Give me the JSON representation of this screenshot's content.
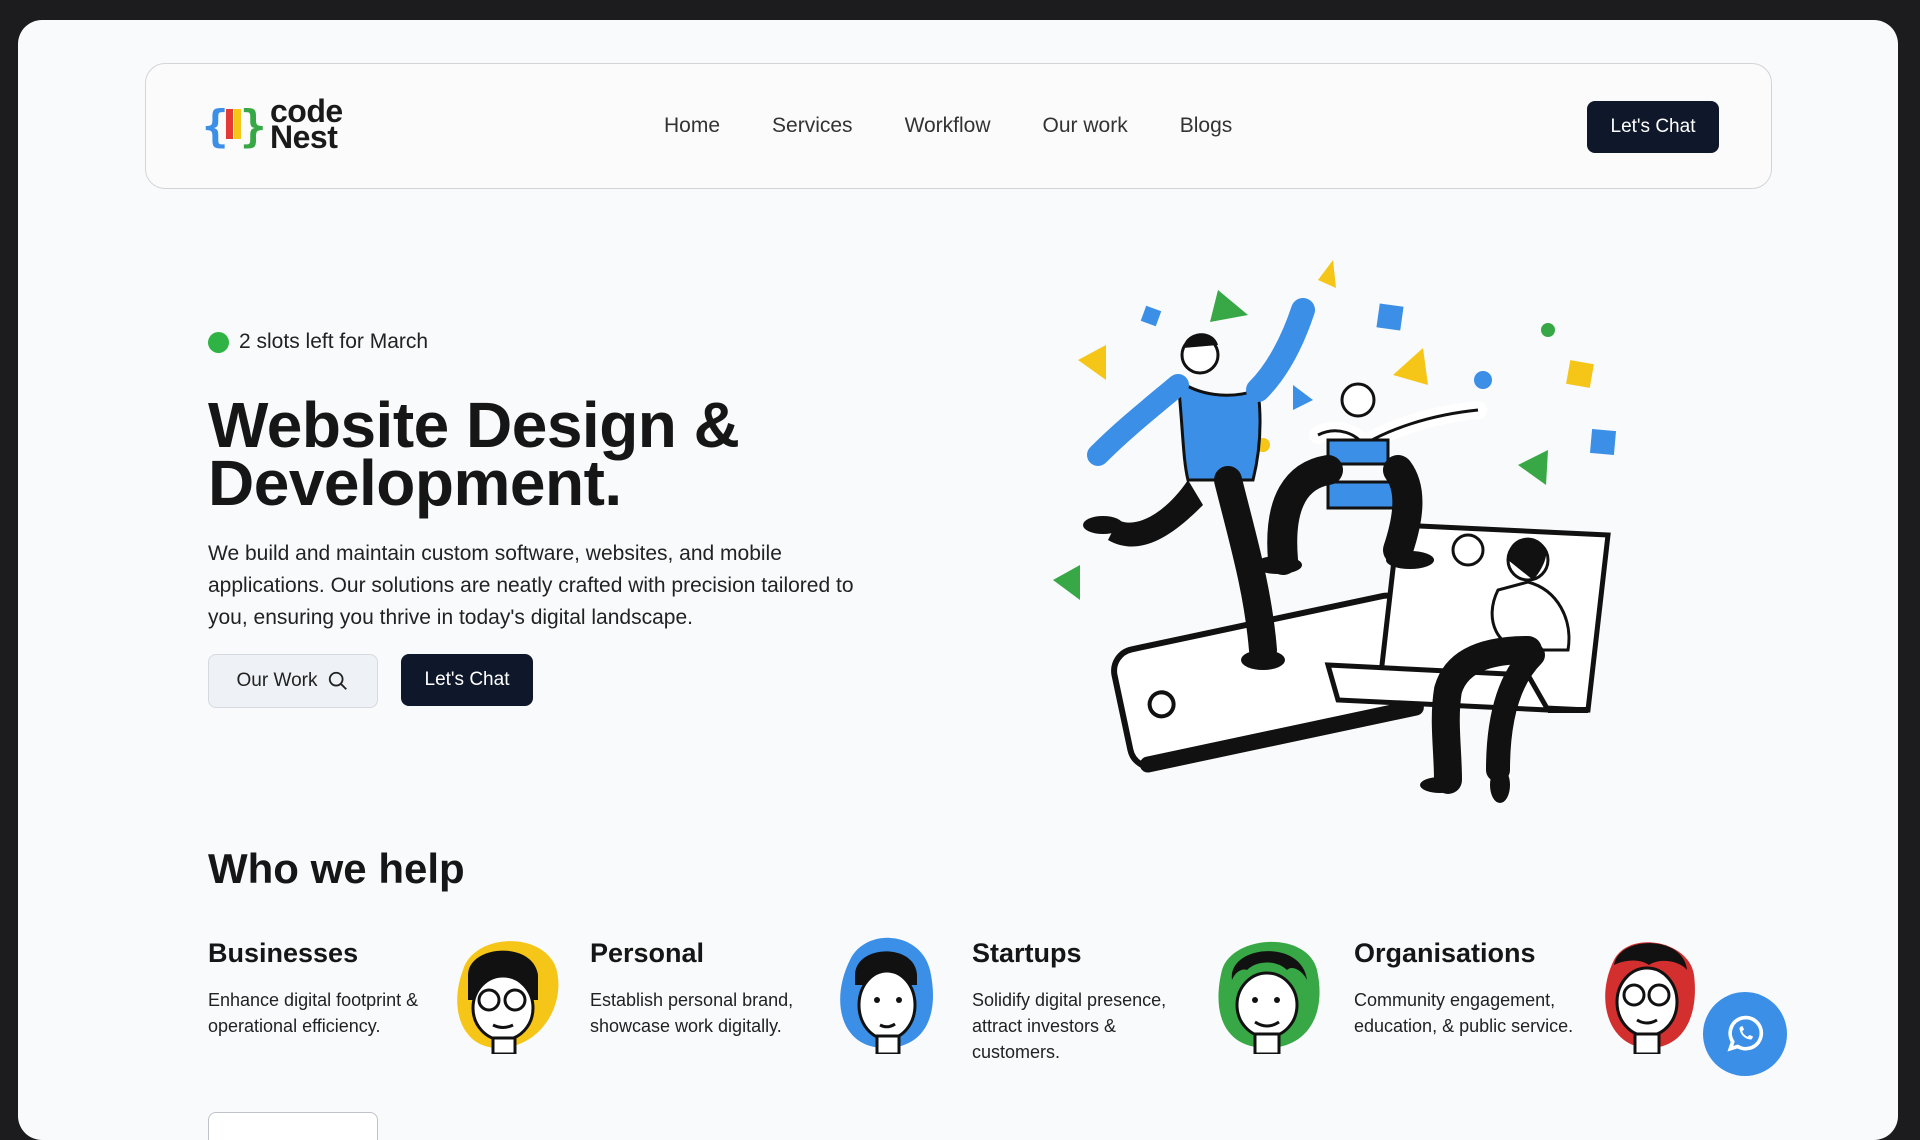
{
  "brand": {
    "line1": "code",
    "line2": "Nest"
  },
  "nav": {
    "links": [
      "Home",
      "Services",
      "Workflow",
      "Our work",
      "Blogs"
    ],
    "cta": "Let's Chat"
  },
  "hero": {
    "badge": "2 slots left for March",
    "title_line1": "Website Design &",
    "title_line2": "Development.",
    "description": "We build and maintain custom software, websites, and mobile applications. Our solutions are neatly crafted with precision tailored to you, ensuring you thrive in today's digital landscape.",
    "btn_work": "Our Work",
    "btn_chat": "Let's Chat"
  },
  "who": {
    "title": "Who we help",
    "cards": [
      {
        "title": "Businesses",
        "text": "Enhance digital footprint & operational efficiency.",
        "avatar_color": "#f5c518"
      },
      {
        "title": "Personal",
        "text": "Establish personal brand, showcase work digitally.",
        "avatar_color": "#3b8fe6"
      },
      {
        "title": "Startups",
        "text": "Solidify digital presence, attract investors & customers.",
        "avatar_color": "#37a845"
      },
      {
        "title": "Organisations",
        "text": "Community engagement, education, & public service.",
        "avatar_color": "#d32f2f"
      }
    ]
  },
  "colors": {
    "dark": "#0f172a",
    "green": "#2fb344",
    "blue": "#3b8fe6",
    "yellow": "#f5c518"
  },
  "icons": {
    "search": "search-icon",
    "whatsapp": "whatsapp-icon"
  }
}
